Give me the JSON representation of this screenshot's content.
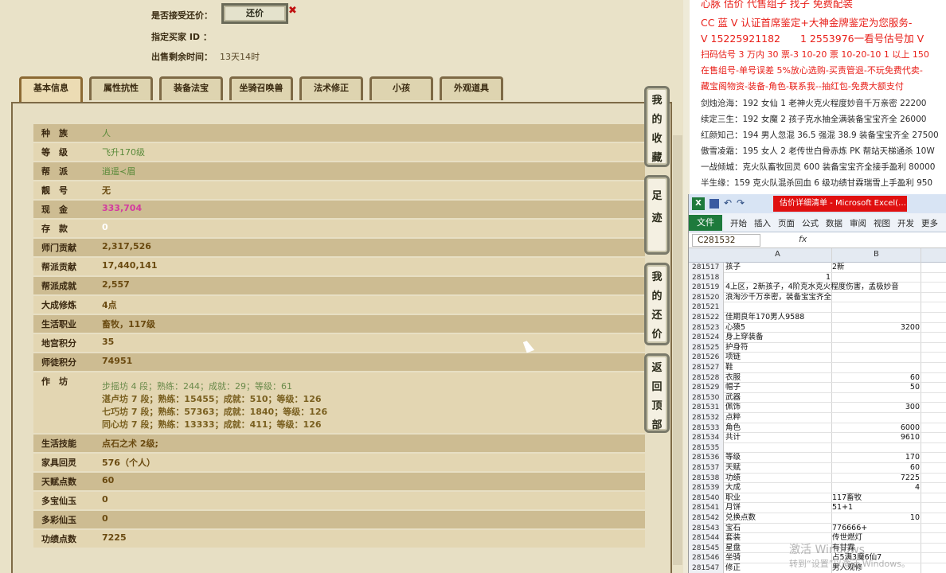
{
  "top": {
    "accept_counter_label": "是否接受还价：",
    "counter_button": "还价",
    "buyer_id_label": "指定买家 ID ：",
    "time_left_label": "出售剩余时间：",
    "time_left_value": "13天14时"
  },
  "tabs": [
    "基本信息",
    "属性抗性",
    "装备法宝",
    "坐骑召唤兽",
    "法术修正",
    "小孩",
    "外观道具"
  ],
  "rows": [
    {
      "label": "种　族",
      "value": "人",
      "style": "green"
    },
    {
      "label": "等　级",
      "value": "飞升170级",
      "style": "green"
    },
    {
      "label": "帮　派",
      "value": "逍遥≺眉",
      "style": "green"
    },
    {
      "label": "靓　号",
      "value": "无",
      "style": ""
    },
    {
      "label": "现　金",
      "value": "333,704",
      "style": "pink"
    },
    {
      "label": "存　款",
      "value": "0",
      "style": "white"
    },
    {
      "label": "师门贡献",
      "value": "2,317,526",
      "style": ""
    },
    {
      "label": "帮派贡献",
      "value": "17,440,141",
      "style": ""
    },
    {
      "label": "帮派成就",
      "value": "2,557",
      "style": ""
    },
    {
      "label": "大成修炼",
      "value": "4点",
      "style": ""
    },
    {
      "label": "生活职业",
      "value": "畜牧，117级",
      "style": ""
    },
    {
      "label": "地宫积分",
      "value": "35",
      "style": ""
    },
    {
      "label": "师徒积分",
      "value": "74951",
      "style": ""
    }
  ],
  "workshop": {
    "label": "作　坊",
    "lines": [
      "步摇坊 4 段；熟练：244；成就：29；等级：61",
      "湛卢坊 7 段；熟练：15455；成就：510；等级：126",
      "七巧坊 7 段；熟练：57363；成就：1840；等级：126",
      "同心坊 7 段；熟练：13333；成就：411；等级：126"
    ]
  },
  "rows2": [
    {
      "label": "生活技能",
      "value": "点石之术 2级;"
    },
    {
      "label": "家具回灵",
      "value": "576（个人）"
    },
    {
      "label": "天赋点数",
      "value": "60"
    },
    {
      "label": "多宝仙玉",
      "value": "0"
    },
    {
      "label": "多彩仙玉",
      "value": "0"
    },
    {
      "label": "功绩点数",
      "value": "7225"
    }
  ],
  "side_buttons": [
    "我的收藏",
    "足迹",
    "我的还价",
    "返回顶部"
  ],
  "ads": [
    {
      "text": "心脉 估价 代售组子 找子 免费配装",
      "style": "red big"
    },
    {
      "text": "CC 蓝 V 认证首席鉴定+大神金牌鉴定为您服务-",
      "style": "red"
    },
    {
      "text": "V 15225921182　　1 2553976一看号估号加 V",
      "style": "red big"
    },
    {
      "text": "扫码估号 3 万内 30 票-3 10-20 票 10-20-10 1 以上 150",
      "style": "red"
    },
    {
      "text": "在售组号-单号误差 5%放心选购-买责管退-不玩免费代卖-",
      "style": "red"
    },
    {
      "text": "藏宝阁物资-装备-角色-联系我--抽红包-免费大额支付",
      "style": "red"
    },
    {
      "text": "剑烛沧海：192 女仙 1 老神火克火程度妙音千万亲密 22200",
      "style": "dark"
    },
    {
      "text": "续定三生：192 女魔 2 孩子克水抽全满装备宝宝齐全 26000",
      "style": "dark"
    },
    {
      "text": "红颜知己：194 男人忽混 36.5 强混 38.9 装备宝宝齐全 27500",
      "style": "dark"
    },
    {
      "text": "傲雪凌霜：195 女人 2 老传世白骨赤炼 PK 帮站天梯通杀 10W",
      "style": "dark"
    },
    {
      "text": "一战倾城：克火队畜牧回灵 600 装备宝宝齐全接手盈利 80000",
      "style": "dark"
    },
    {
      "text": "半生缘：159 克火队混杀回血 6 级功绩甘霖瑞雪上手盈利 950",
      "style": "dark"
    }
  ],
  "excel": {
    "title": "估价详细清单 - Microsoft Excel(…",
    "file_tab": "文件",
    "tabs": [
      "开始",
      "插入",
      "页面",
      "公式",
      "数据",
      "审阅",
      "视图",
      "开发",
      "更多"
    ],
    "name_box": "C281532",
    "fx": "fx",
    "col_a": "A",
    "col_b": "B",
    "rows": [
      {
        "n": "281517",
        "a": "孩子",
        "b": "2新",
        "bnum": false
      },
      {
        "n": "281518",
        "a": "1",
        "b": "",
        "anum": true
      },
      {
        "n": "281519",
        "a": "4上区，2新孩子，4阶克水克火程度伤害，孟极妙音",
        "b": ""
      },
      {
        "n": "281520",
        "a": "浪淘沙千万亲密，装备宝宝齐全",
        "b": ""
      },
      {
        "n": "281521",
        "a": "",
        "b": ""
      },
      {
        "n": "281522",
        "a": "佳期良年170男人9588",
        "b": ""
      },
      {
        "n": "281523",
        "a": "心猿5",
        "b": "3200",
        "bnum": true
      },
      {
        "n": "281524",
        "a": "身上穿装备",
        "b": ""
      },
      {
        "n": "281525",
        "a": "护身符",
        "b": ""
      },
      {
        "n": "281526",
        "a": "项链",
        "b": ""
      },
      {
        "n": "281527",
        "a": "鞋",
        "b": ""
      },
      {
        "n": "281528",
        "a": "衣服",
        "b": "60",
        "bnum": true
      },
      {
        "n": "281529",
        "a": "帽子",
        "b": "50",
        "bnum": true
      },
      {
        "n": "281530",
        "a": "武器",
        "b": ""
      },
      {
        "n": "281531",
        "a": "佩饰",
        "b": "300",
        "bnum": true
      },
      {
        "n": "281532",
        "a": "点粹",
        "b": ""
      },
      {
        "n": "281533",
        "a": "角色",
        "b": "6000",
        "bnum": true
      },
      {
        "n": "281534",
        "a": "共计",
        "b": "9610",
        "bnum": true
      },
      {
        "n": "281535",
        "a": "",
        "b": ""
      },
      {
        "n": "281536",
        "a": "等级",
        "b": "170",
        "bnum": true
      },
      {
        "n": "281537",
        "a": "天赋",
        "b": "60",
        "bnum": true
      },
      {
        "n": "281538",
        "a": "功绩",
        "b": "7225",
        "bnum": true
      },
      {
        "n": "281539",
        "a": "大成",
        "b": "4",
        "bnum": true
      },
      {
        "n": "281540",
        "a": "职业",
        "b": "117畜牧",
        "bnum": false
      },
      {
        "n": "281541",
        "a": "月饼",
        "b": "51+1",
        "bnum": false
      },
      {
        "n": "281542",
        "a": "兑换点数",
        "b": "10",
        "bnum": true
      },
      {
        "n": "281543",
        "a": "宝石",
        "b": "776666+",
        "bnum": false
      },
      {
        "n": "281544",
        "a": "套装",
        "b": "传世燃灯",
        "bnum": false
      },
      {
        "n": "281545",
        "a": "星盘",
        "b": "有甘霖",
        "bnum": false
      },
      {
        "n": "281546",
        "a": "坐骑",
        "b": "占5满3魔6仙7",
        "bnum": false
      },
      {
        "n": "281547",
        "a": "修正",
        "b": "男人观修",
        "bnum": false
      }
    ],
    "watermark": "激活 Windows",
    "watermark2": "转到“设置”以激活 Windows。"
  }
}
